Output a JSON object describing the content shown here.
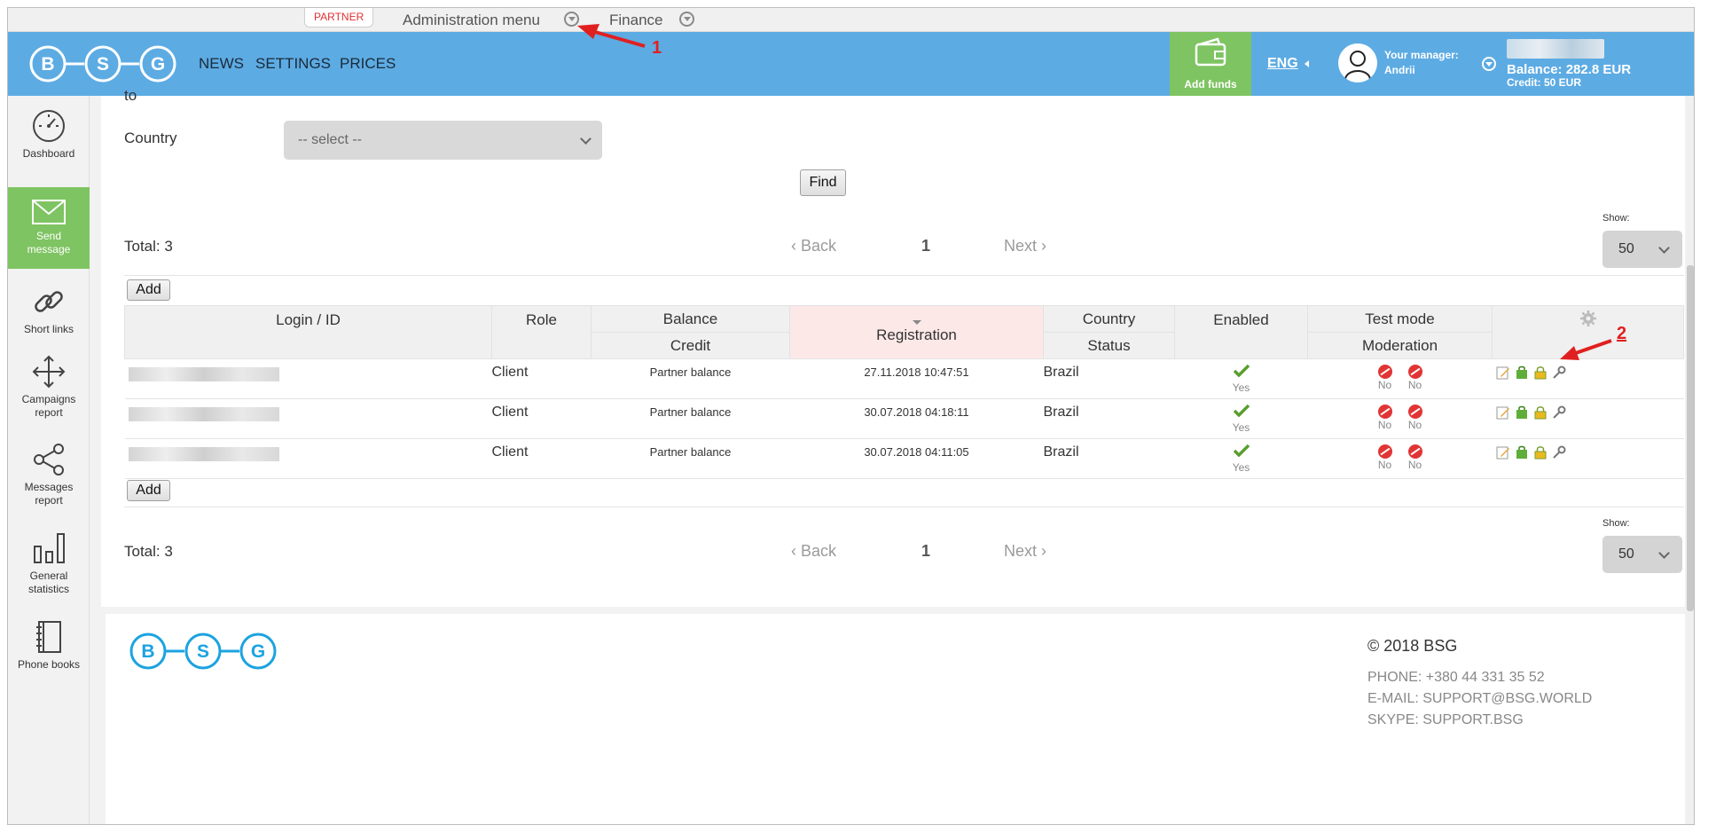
{
  "adminbar": {
    "partner_badge": "PARTNER",
    "admin_menu": "Administration menu",
    "finance": "Finance"
  },
  "header": {
    "logo_letters": [
      "B",
      "S",
      "G"
    ],
    "nav": [
      "NEWS",
      "SETTINGS",
      "PRICES"
    ],
    "add_funds": "Add funds",
    "lang": "ENG",
    "manager_label": "Your manager:",
    "manager_name": "Andrii",
    "balance": "Balance: 282.8 EUR",
    "credit": "Credit: 50 EUR"
  },
  "sidebar": {
    "items": [
      {
        "label": "Dashboard",
        "icon": "speedometer-icon"
      },
      {
        "label": "Send message",
        "icon": "envelope-icon"
      },
      {
        "label": "Short links",
        "icon": "link-icon"
      },
      {
        "label": "Campaigns report",
        "icon": "move-arrows-icon"
      },
      {
        "label": "Messages report",
        "icon": "share-icon"
      },
      {
        "label": "General statistics",
        "icon": "bar-chart-icon"
      },
      {
        "label": "Phone books",
        "icon": "notebook-icon"
      }
    ]
  },
  "filter": {
    "to_label": "to",
    "country_label": "Country",
    "country_select": "-- select --",
    "find_button": "Find"
  },
  "pagination": {
    "total": "Total: 3",
    "back": "Back",
    "page": "1",
    "next": "Next",
    "show_label": "Show:",
    "show_value": "50"
  },
  "table": {
    "add_button": "Add",
    "headers": {
      "login": "Login / ID",
      "role": "Role",
      "balance": "Balance",
      "credit": "Credit",
      "registration": "Registration",
      "country": "Country",
      "status": "Status",
      "enabled": "Enabled",
      "test_mode": "Test mode",
      "moderation": "Moderation"
    },
    "rows": [
      {
        "role": "Client",
        "balance": "Partner balance",
        "registration": "27.11.2018 10:47:51",
        "country": "Brazil",
        "enabled": "Yes",
        "test_mode": "No",
        "moderation": "No"
      },
      {
        "role": "Client",
        "balance": "Partner balance",
        "registration": "30.07.2018 04:18:11",
        "country": "Brazil",
        "enabled": "Yes",
        "test_mode": "No",
        "moderation": "No"
      },
      {
        "role": "Client",
        "balance": "Partner balance",
        "registration": "30.07.2018 04:11:05",
        "country": "Brazil",
        "enabled": "Yes",
        "test_mode": "No",
        "moderation": "No"
      }
    ]
  },
  "footer": {
    "copyright": "© 2018 BSG",
    "phone": "PHONE: +380 44 331 35 52",
    "email": "E-MAIL: SUPPORT@BSG.WORLD",
    "skype": "SKYPE: SUPPORT.BSG"
  },
  "annotations": {
    "one": "1",
    "two": "2"
  },
  "colors": {
    "header_blue": "#5dabe3",
    "accent_green": "#7ec462",
    "logo_blue": "#1ba3e0",
    "annotation_red": "#e02020"
  }
}
